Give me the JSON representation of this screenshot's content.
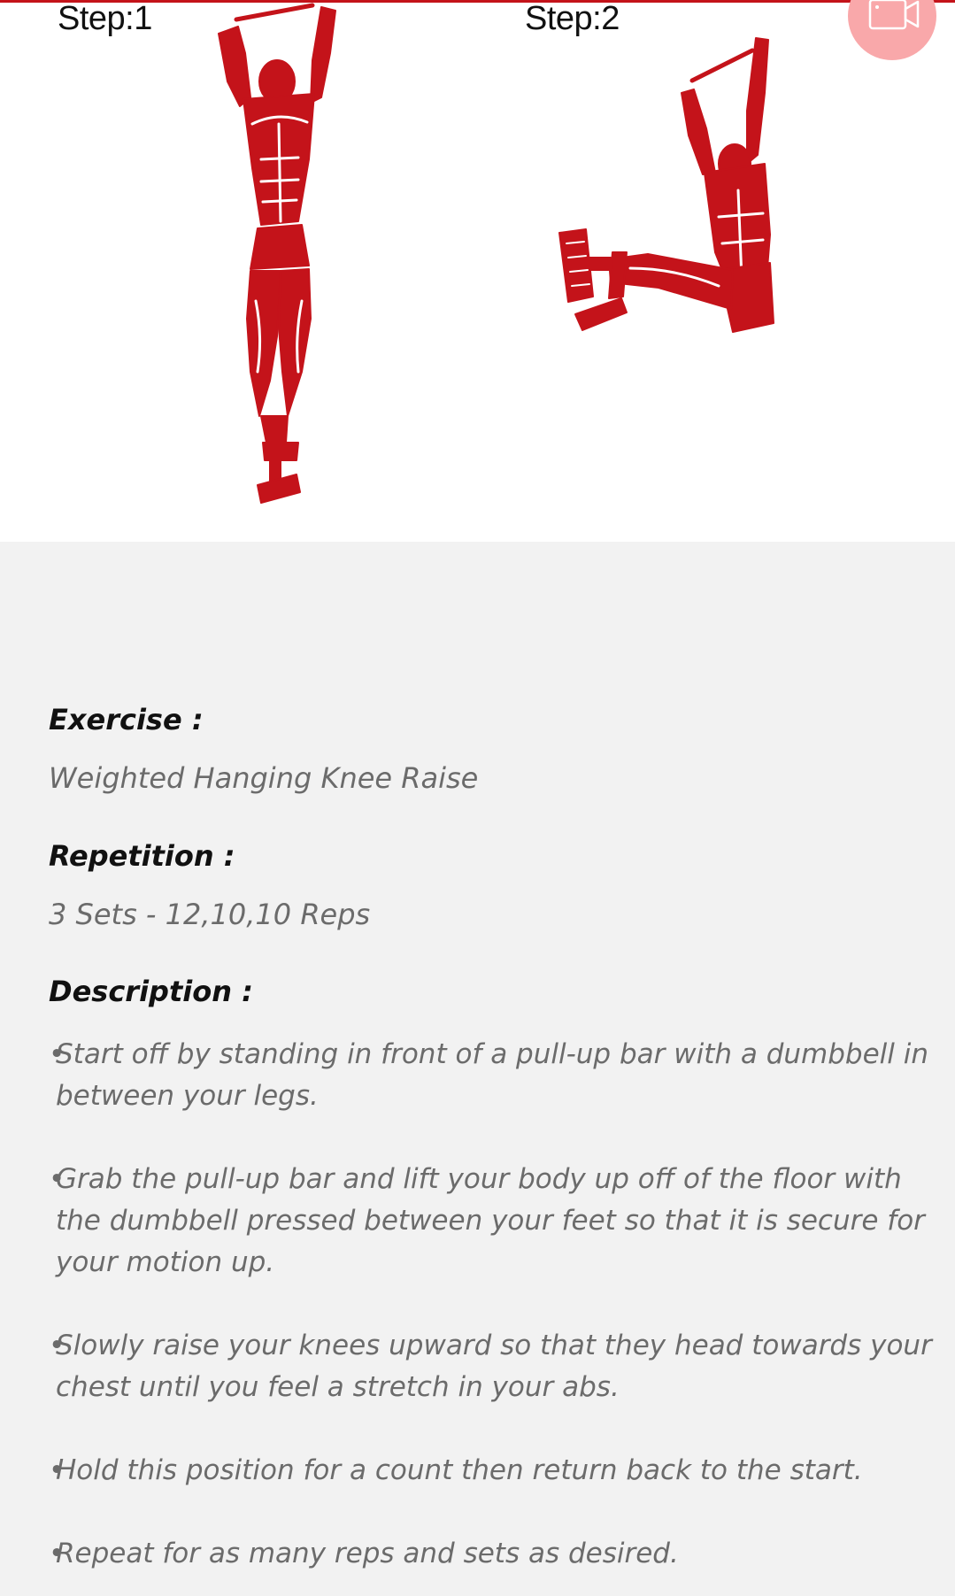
{
  "steps": [
    {
      "label": "Step:1"
    },
    {
      "label": "Step:2"
    }
  ],
  "video_button": {
    "icon": "video-camera-icon"
  },
  "colors": {
    "accent": "#c4131a",
    "figure": "#c4131a",
    "fab": "#f9a8aa",
    "label_text": "#111111",
    "value_text": "#6b6b6b",
    "background": "#f2f2f2"
  },
  "details": {
    "exercise_label": "Exercise :",
    "exercise_value": "Weighted Hanging Knee Raise",
    "repetition_label": "Repetition :",
    "repetition_value": "3 Sets - 12,10,10 Reps",
    "description_label": "Description :",
    "bullet": "•",
    "description": [
      "Start off by standing in front of a pull-up bar with a dumbbell in between your legs.",
      "Grab the pull-up bar and lift your body up off of the floor with the dumbbell pressed between your feet so that it is secure for your motion up.",
      "Slowly raise your knees upward so that they head towards your chest until you feel a stretch in your abs.",
      "Hold this position for a count then return back to the start.",
      "Repeat for as many reps and sets as desired."
    ]
  }
}
